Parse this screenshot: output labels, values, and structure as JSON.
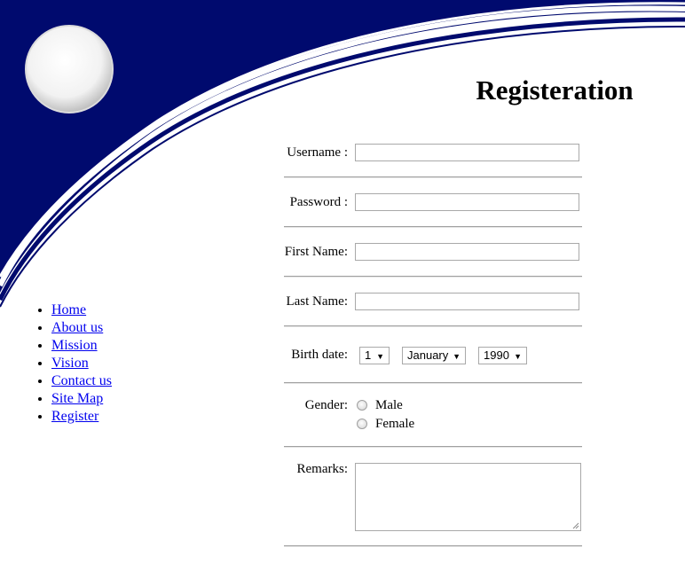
{
  "page": {
    "title": "Registeration"
  },
  "nav": {
    "items": [
      "Home",
      "About us",
      "Mission",
      "Vision",
      "Contact us",
      "Site Map",
      "Register"
    ]
  },
  "form": {
    "username_label": "Username :",
    "username_value": "",
    "password_label": "Password :",
    "password_value": "",
    "firstname_label": "First Name:",
    "firstname_value": "",
    "lastname_label": "Last Name:",
    "lastname_value": "",
    "birthdate_label": "Birth date:",
    "birth_day": "1",
    "birth_month": "January",
    "birth_year": "1990",
    "gender_label": "Gender:",
    "gender_options": [
      "Male",
      "Female"
    ],
    "remarks_label": "Remarks:",
    "remarks_value": ""
  },
  "colors": {
    "banner_navy": "#000a6e",
    "link": "#0000ee"
  }
}
